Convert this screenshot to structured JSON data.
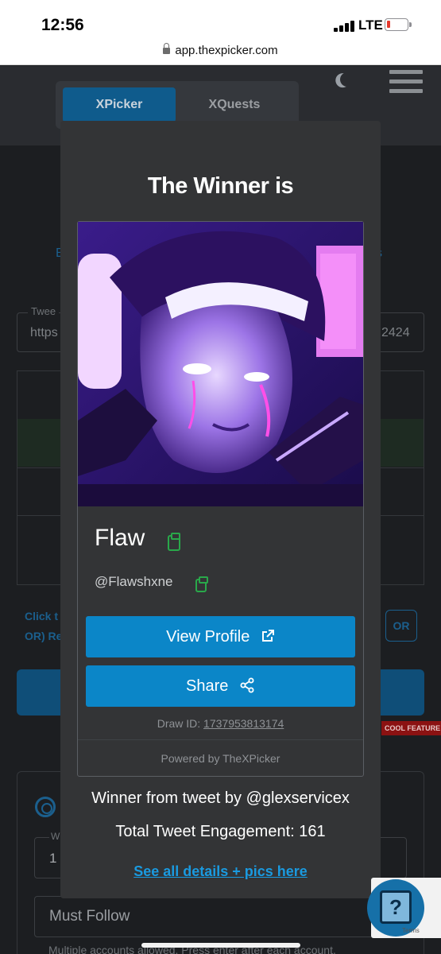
{
  "status_bar": {
    "time": "12:56",
    "network": "LTE"
  },
  "browser": {
    "url": "app.thexpicker.com"
  },
  "app_header": {
    "tabs": [
      {
        "label": "XPicker",
        "active": true
      },
      {
        "label": "XQuests",
        "active": false
      }
    ]
  },
  "background": {
    "tweet_label": "Twee",
    "tweet_value_start": "https",
    "tweet_value_end": "2424",
    "left_link": "E",
    "right_link": "s",
    "click_text": "Click t",
    "or_text": "OR) Re",
    "or_button": "OR",
    "cool_feature_badge": "COOL FEATURE",
    "settings_field_label": "W",
    "settings_field_value": "1",
    "must_follow_placeholder": "Must Follow",
    "must_follow_help": "Multiple accounts allowed. Press enter after each account."
  },
  "modal": {
    "title": "The Winner is",
    "winner_name": "Flaw",
    "winner_handle": "@Flawshxne",
    "view_profile_label": "View Profile",
    "share_label": "Share",
    "draw_id_label": "Draw ID:",
    "draw_id": "1737953813174",
    "powered_by": "Powered by TheXPicker",
    "from_tweet": "Winner from tweet by @glexservicex",
    "engagement": "Total Tweet Engagement: 161",
    "details_link": "See all details + pics here"
  },
  "recaptcha": {
    "terms": "Terms"
  },
  "colors": {
    "accent": "#0b86c8",
    "copy_icon": "#29a84a",
    "modal_bg": "#333436",
    "link": "#1a9ae0"
  }
}
